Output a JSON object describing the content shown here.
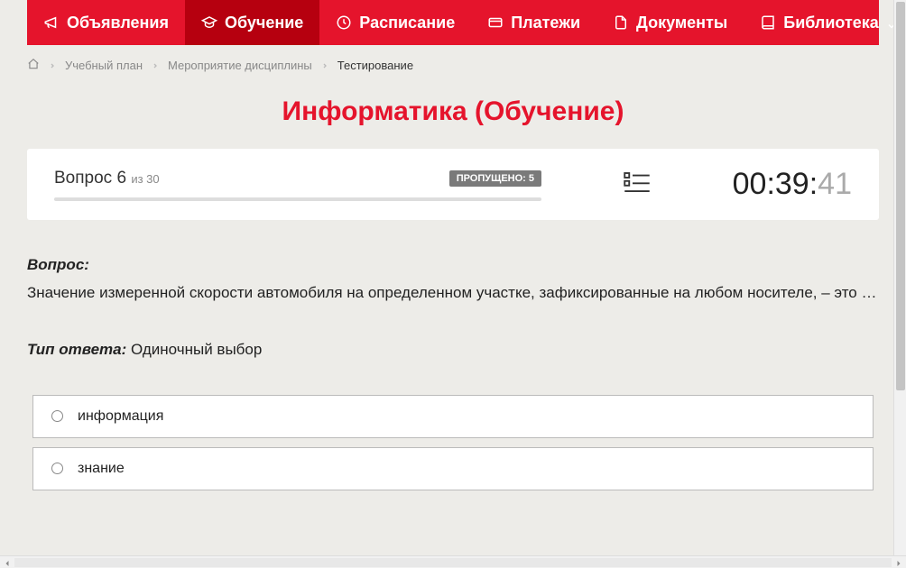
{
  "nav": {
    "items": [
      {
        "label": "Объявления",
        "icon": "megaphone"
      },
      {
        "label": "Обучение",
        "icon": "graduation"
      },
      {
        "label": "Расписание",
        "icon": "clock"
      },
      {
        "label": "Платежи",
        "icon": "card"
      },
      {
        "label": "Документы",
        "icon": "doc"
      },
      {
        "label": "Библиотека",
        "icon": "book"
      }
    ],
    "active_index": 1
  },
  "breadcrumb": {
    "items": [
      {
        "label": "Учебный план"
      },
      {
        "label": "Мероприятие дисциплины"
      },
      {
        "label": "Тестирование"
      }
    ]
  },
  "page_title": "Информатика (Обучение)",
  "status": {
    "question_word": "Вопрос",
    "question_num": "6",
    "of_word": "из",
    "total": "30",
    "skipped_label": "ПРОПУЩЕНО: 5",
    "timer_main": "00:39:",
    "timer_sec": "41"
  },
  "question": {
    "label": "Вопрос:",
    "text": "Значение измеренной скорости автомобиля на определенном участке, зафиксированные на любом носителе, – это …",
    "answer_type_label": "Тип ответа:",
    "answer_type_value": "Одиночный выбор",
    "options": [
      {
        "text": "информация"
      },
      {
        "text": "знание"
      }
    ]
  }
}
